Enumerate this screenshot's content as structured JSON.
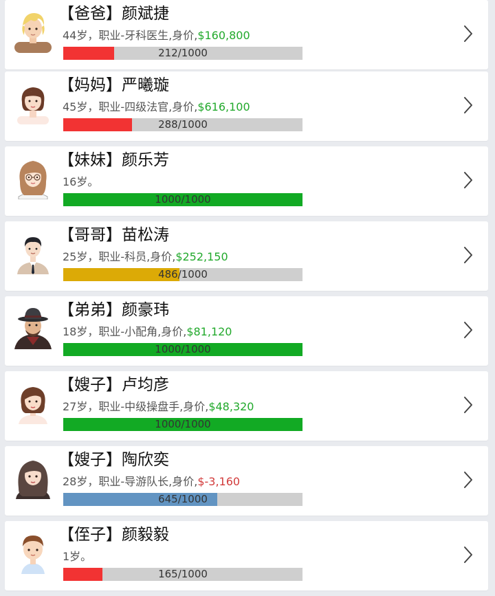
{
  "members": [
    {
      "title": "【爸爸】",
      "name": "颜斌捷",
      "info": "44岁，职业-牙科医生,身价,",
      "money": "$160,800",
      "money_negative": false,
      "progress_value": 212,
      "progress_max": 1000,
      "progress_text": "212/1000",
      "bar_color": "#f23333",
      "avatar": "blonde-man-avatar-icon"
    },
    {
      "title": "【妈妈】",
      "name": "严曦璇",
      "info": "45岁，职业-四级法官,身价,",
      "money": "$616,100",
      "money_negative": false,
      "progress_value": 288,
      "progress_max": 1000,
      "progress_text": "288/1000",
      "bar_color": "#f23333",
      "avatar": "woman-short-hair-avatar-icon"
    },
    {
      "title": "【妹妹】",
      "name": "颜乐芳",
      "info": "16岁。",
      "money": "",
      "money_negative": false,
      "progress_value": 1000,
      "progress_max": 1000,
      "progress_text": "1000/1000",
      "bar_color": "#12aa24",
      "avatar": "girl-glasses-avatar-icon"
    },
    {
      "title": "【哥哥】",
      "name": "苗松涛",
      "info": "25岁，职业-科员,身价,",
      "money": "$252,150",
      "money_negative": false,
      "progress_value": 486,
      "progress_max": 1000,
      "progress_text": "486/1000",
      "bar_color": "#dcaa06",
      "avatar": "man-suit-avatar-icon"
    },
    {
      "title": "【弟弟】",
      "name": "颜豪玮",
      "info": "18岁，职业-小配角,身价,",
      "money": "$81,120",
      "money_negative": false,
      "progress_value": 1000,
      "progress_max": 1000,
      "progress_text": "1000/1000",
      "bar_color": "#12aa24",
      "avatar": "man-fedora-avatar-icon"
    },
    {
      "title": "【嫂子】",
      "name": "卢均彦",
      "info": "27岁，职业-中级操盘手,身价,",
      "money": "$48,320",
      "money_negative": false,
      "progress_value": 1000,
      "progress_max": 1000,
      "progress_text": "1000/1000",
      "bar_color": "#12aa24",
      "avatar": "woman-bob-hair-avatar-icon"
    },
    {
      "title": "【嫂子】",
      "name": "陶欣奕",
      "info": "28岁，职业-导游队长,身价,",
      "money": "$-3,160",
      "money_negative": true,
      "progress_value": 645,
      "progress_max": 1000,
      "progress_text": "645/1000",
      "bar_color": "#6294c2",
      "avatar": "woman-long-hair-avatar-icon"
    },
    {
      "title": "【侄子】",
      "name": "颜毅毅",
      "info": "1岁。",
      "money": "",
      "money_negative": false,
      "progress_value": 165,
      "progress_max": 1000,
      "progress_text": "165/1000",
      "bar_color": "#f23333",
      "avatar": "baby-boy-avatar-icon"
    }
  ]
}
